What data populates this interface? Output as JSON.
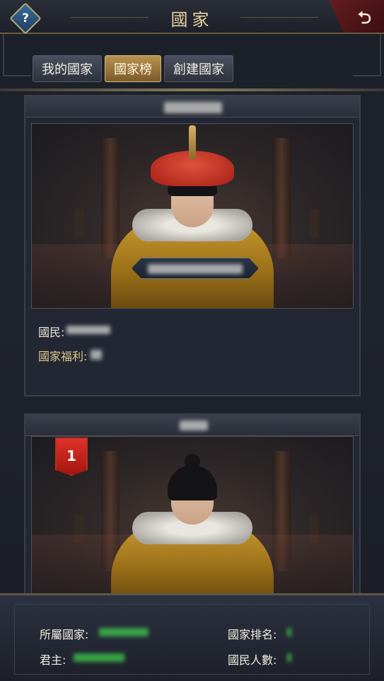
{
  "header": {
    "title": "國家",
    "help_glyph": "?",
    "back_glyph": "⮌"
  },
  "tabs": [
    {
      "label": "我的國家",
      "active": false
    },
    {
      "label": "國家榜",
      "active": true
    },
    {
      "label": "創建國家",
      "active": false
    }
  ],
  "card1": {
    "citizens_label": "國民:",
    "welfare_label": "國家福利:"
  },
  "card2": {
    "rank": "1"
  },
  "bottom": {
    "belong_label": "所屬國家:",
    "rank_label": "國家排名:",
    "ruler_label": "君主:",
    "population_label": "國民人數:"
  },
  "colors": {
    "accent_gold": "#e0c98a",
    "active_tab": "#b9924f",
    "rank_red": "#e0322a"
  },
  "icons": {
    "help": "help-diamond-icon",
    "back": "back-arrow-icon"
  }
}
